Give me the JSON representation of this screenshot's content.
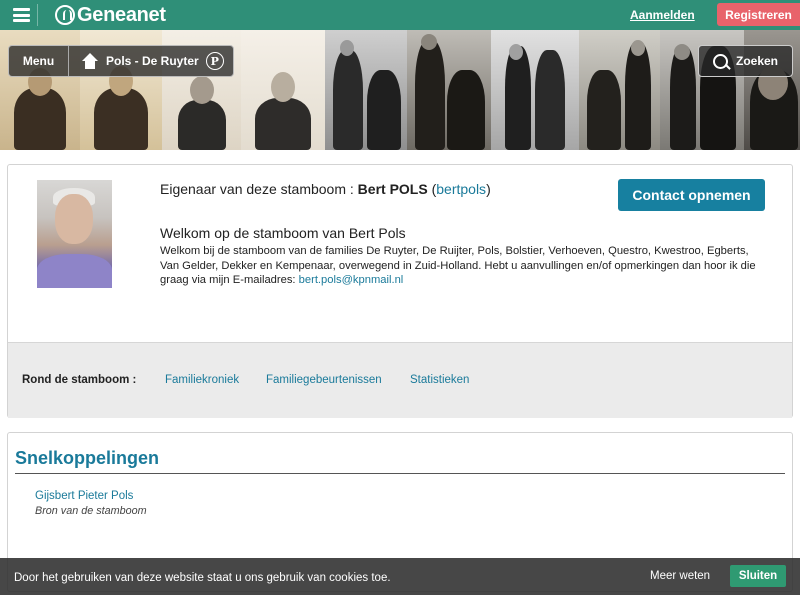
{
  "header": {
    "logo_text": "Geneanet",
    "login_label": "Aanmelden",
    "register_label": "Registreren"
  },
  "banner": {
    "menu_label": "Menu",
    "tree_name": "Pols - De Ruyter",
    "premium_badge": "P",
    "search_label": "Zoeken"
  },
  "owner": {
    "prefix": "Eigenaar van deze stamboom : ",
    "name": "Bert POLS",
    "handle_open": " (",
    "handle": "bertpols",
    "handle_close": ")",
    "contact_label": "Contact opnemen",
    "welcome_title": "Welkom op de stamboom van Bert Pols",
    "welcome_text": "Welkom bij de stamboom van de families De Ruyter, De Ruijter, Pols, Bolstier, Verhoeven, Questro, Kwestroo, Egberts, Van Gelder, Dekker en Kempenaar, overwegend in Zuid-Holland.  Hebt u aanvullingen en/of opmerkingen dan hoor ik die graag via mijn E-mailadres: ",
    "email": "bert.pols@kpnmail.nl"
  },
  "rond": {
    "label": "Rond de stamboom :",
    "links": [
      "Familiekroniek",
      "Familiegebeurtenissen",
      "Statistieken"
    ]
  },
  "snelkoppelingen": {
    "title": "Snelkoppelingen",
    "person_name": "Gijsbert Pieter Pols",
    "person_sub": "Bron van de stamboom"
  },
  "cookie": {
    "text": "Door het gebruiken van deze website staat u ons gebruik van cookies toe.",
    "more_label": "Meer weten",
    "close_label": "Sluiten"
  },
  "colors": {
    "header_bg": "#2f8f78",
    "register_bg": "#e8636b",
    "link": "#1a7a9a",
    "contact_bg": "#1780a0",
    "cookie_btn": "#2f9a72"
  }
}
